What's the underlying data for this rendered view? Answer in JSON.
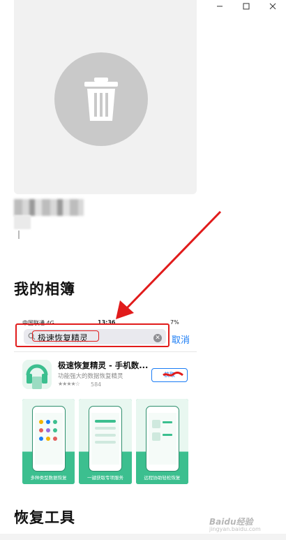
{
  "window": {
    "controls": {
      "minimize_icon": "minimize-icon",
      "maximize_icon": "maximize-icon",
      "close_icon": "close-icon"
    }
  },
  "trash_card": {
    "icon": "trash-icon",
    "background": "#f1f1f1",
    "circle_color": "#c9c9c9"
  },
  "sections": {
    "my_albums": "我的相簿",
    "recovery_tools": "恢复工具"
  },
  "phone_screenshot": {
    "status": {
      "carrier": "中国联通  4G",
      "time": "13:36",
      "battery": "7%"
    },
    "search": {
      "query": "极速恢复精灵",
      "cancel_label": "取消"
    },
    "app": {
      "name": "极速恢复精灵 - 手机数...",
      "subtitle": "功能强大的数据恢复精灵",
      "stars": "★★★★☆",
      "rating_count": "584",
      "get_label": "获取"
    },
    "screenshots": [
      {
        "caption": "多种类型数据恢复"
      },
      {
        "caption": "一键获取专项服务"
      },
      {
        "caption": "远程协助轻松恢复"
      }
    ]
  },
  "watermark": {
    "text": "Baidu经验",
    "sub": "jingyan.baidu.com"
  },
  "colors": {
    "annotation_red": "#e11b1b",
    "accent_blue": "#1a7cf5",
    "app_green": "#3cbf8f"
  }
}
